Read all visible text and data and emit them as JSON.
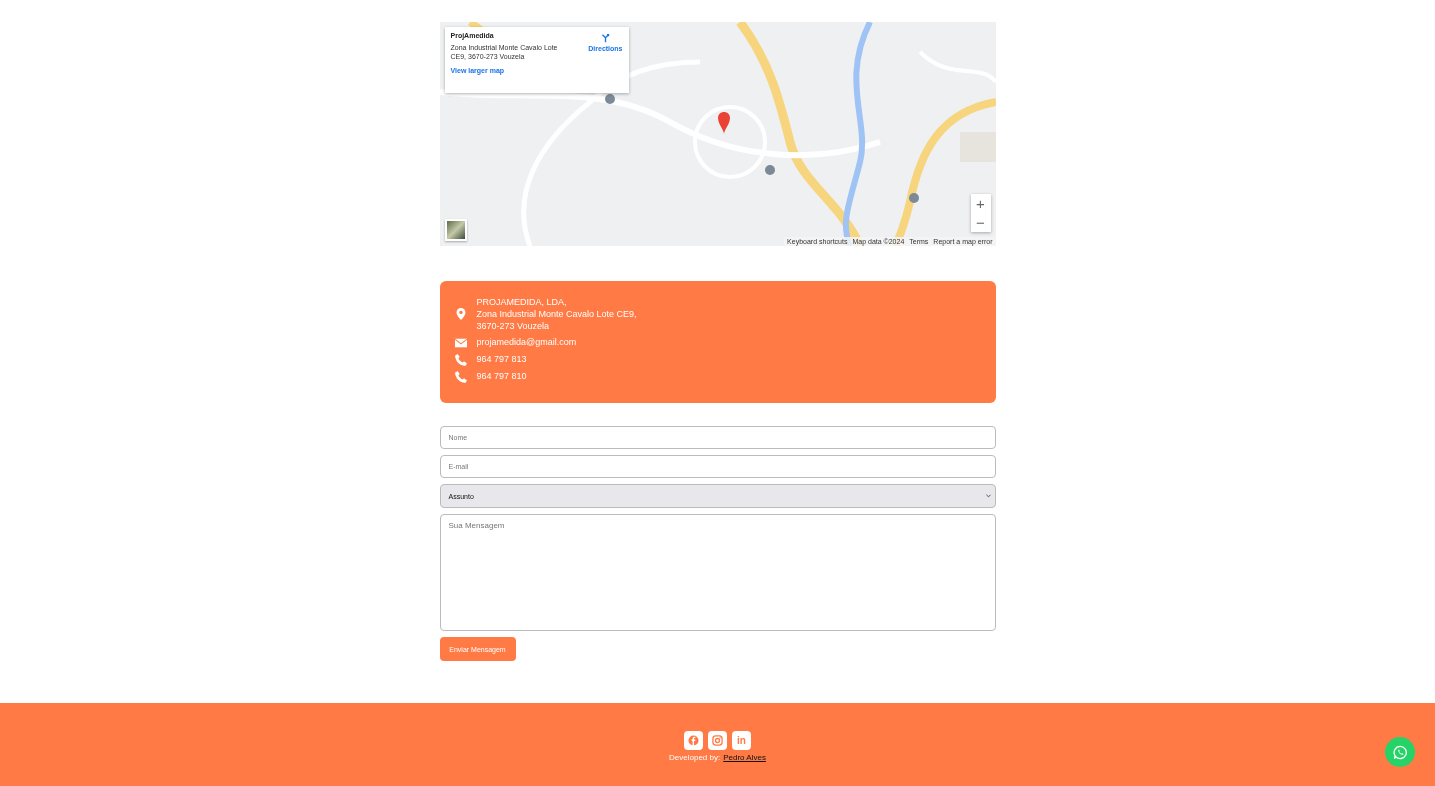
{
  "map": {
    "info_card": {
      "title": "ProjAmedida",
      "address": "Zona Industrial Monte Cavalo Lote CE9, 3670-273 Vouzela",
      "directions": "Directions",
      "larger_map": "View larger map"
    },
    "zoom_in": "+",
    "zoom_out": "−",
    "attribution": [
      "Keyboard shortcuts",
      "Map data ©2024",
      "Terms",
      "Report a map error"
    ]
  },
  "contact": {
    "address_lines": [
      "PROJAMEDIDA, LDA,",
      "Zona Industrial Monte Cavalo Lote CE9,",
      "3670-273 Vouzela"
    ],
    "items": [
      {
        "kind": "email",
        "text": "projamedida@gmail.com"
      },
      {
        "kind": "phone",
        "text": "964 797 813"
      },
      {
        "kind": "phone",
        "text": "964 797 810"
      }
    ]
  },
  "form": {
    "name_placeholder": "Nome",
    "email_placeholder": "E-mail",
    "subject": "Assunto",
    "message_placeholder": "Sua Mensagem",
    "submit": "Enviar Mensagem"
  },
  "footer": {
    "socials": [
      {
        "kind": "facebook"
      },
      {
        "kind": "instagram"
      },
      {
        "kind": "linkedin",
        "glyph": "in"
      }
    ],
    "credit": "Developed by:",
    "author": "Pedro Alves"
  }
}
